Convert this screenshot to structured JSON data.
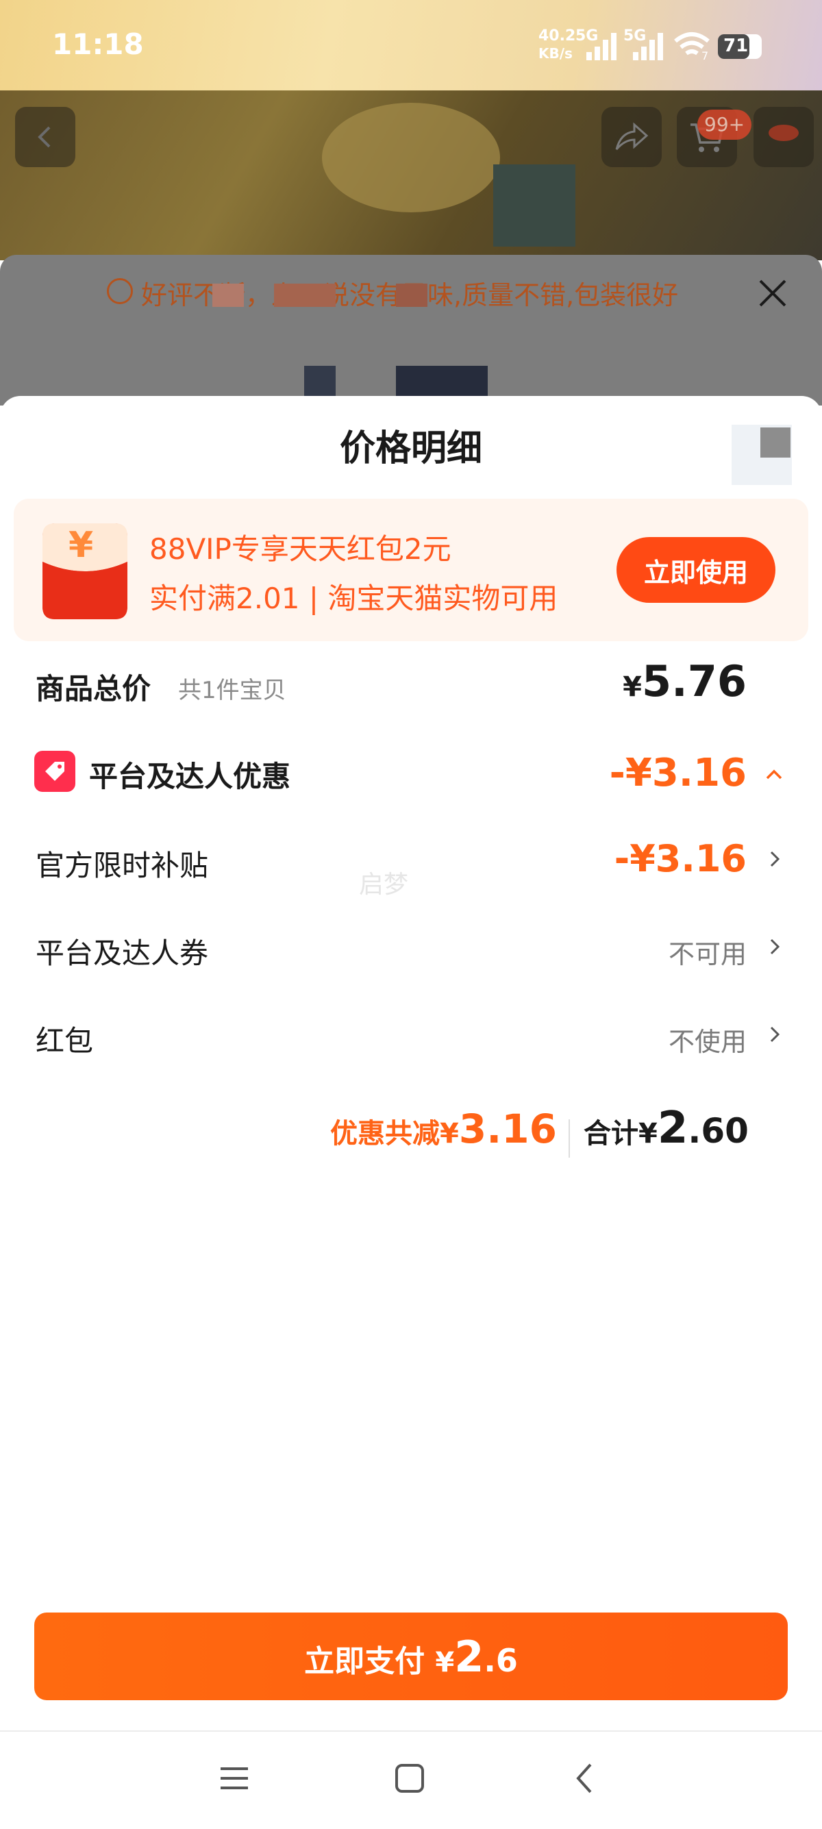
{
  "status_bar": {
    "time": "11:18",
    "net_speed_value": "40.2",
    "net_speed_unit": "KB/s",
    "sim1_label": "5G",
    "sim2_label": "5G",
    "wifi_label": "7",
    "battery": "71"
  },
  "background": {
    "cart_badge": "99+",
    "review_text": "好评不断，上面说没有异味,质量不错,包装很好"
  },
  "sheet": {
    "title": "价格明细"
  },
  "vip_banner": {
    "title": "88VIP专享天天红包2元",
    "subtitle": "实付满2.01 | 淘宝天猫实物可用",
    "button": "立即使用",
    "packet_symbol": "¥"
  },
  "items_total": {
    "label": "商品总价",
    "note": "共1件宝贝",
    "currency": "¥",
    "amount": "5.76"
  },
  "discount": {
    "label": "平台及达人优惠",
    "amount": "-¥3.16",
    "rows": [
      {
        "label": "官方限时补贴",
        "value": "-¥3.16"
      },
      {
        "label": "平台及达人券",
        "value": "不可用"
      },
      {
        "label": "红包",
        "value": "不使用"
      }
    ]
  },
  "watermark": "启梦",
  "summary": {
    "saved_label": "优惠共减¥",
    "saved_amount": "3.16",
    "total_label": "合计¥",
    "total_int": "2",
    "total_dec": ".60"
  },
  "pay_button": {
    "label": "立即支付",
    "currency": "¥",
    "amount_int": "2",
    "amount_dec": ".6"
  },
  "colors": {
    "accent": "#ff6316",
    "vip_button": "#ff4a14",
    "vip_bg": "#fff5ee",
    "promo_icon": "#ff2e4d"
  }
}
